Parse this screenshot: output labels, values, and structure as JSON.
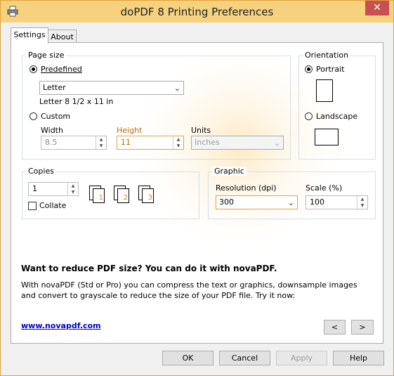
{
  "window": {
    "title": "doPDF 8 Printing Preferences",
    "close_glyph": "✕"
  },
  "tabs": [
    {
      "label": "Settings",
      "active": true
    },
    {
      "label": "About",
      "active": false
    }
  ],
  "page_size": {
    "legend": "Page size",
    "predefined_label": "Predefined",
    "predefined_selected": true,
    "dropdown_value": "Letter",
    "description": "Letter 8 1/2 x 11 in",
    "custom_label": "Custom",
    "width_label": "Width",
    "width_value": "8.5",
    "height_label": "Height",
    "height_value": "11",
    "units_label": "Units",
    "units_value": "Inches"
  },
  "orientation": {
    "legend": "Orientation",
    "portrait_label": "Portrait",
    "portrait_selected": true,
    "landscape_label": "Landscape"
  },
  "copies": {
    "legend": "Copies",
    "value": "1",
    "collate_label": "Collate",
    "collate_checked": false,
    "pages": [
      "1",
      "1",
      "2",
      "2",
      "3",
      "3"
    ]
  },
  "graphic": {
    "legend": "Graphic",
    "resolution_label": "Resolution (dpi)",
    "resolution_value": "300",
    "scale_label": "Scale (%)",
    "scale_value": "100"
  },
  "promo": {
    "headline": "Want to reduce PDF size? You can do it with novaPDF.",
    "body": "With novaPDF (Std or Pro) you can compress the text or graphics, downsample images and convert to grayscale to reduce the size of your PDF file. Try it now:",
    "link": "www.novapdf.com",
    "prev_label": "<",
    "next_label": ">"
  },
  "buttons": {
    "ok": "OK",
    "cancel": "Cancel",
    "apply": "Apply",
    "help": "Help"
  },
  "colors": {
    "title_bar": "#f6d27f",
    "close_button": "#c75050",
    "accent_orange": "#e3a23a",
    "link": "#0000cc"
  },
  "icons": [
    "printer-icon",
    "close-icon",
    "chevron-down-icon",
    "spin-arrows-icon",
    "portrait-page-icon",
    "landscape-page-icon",
    "copies-pages-icon"
  ]
}
